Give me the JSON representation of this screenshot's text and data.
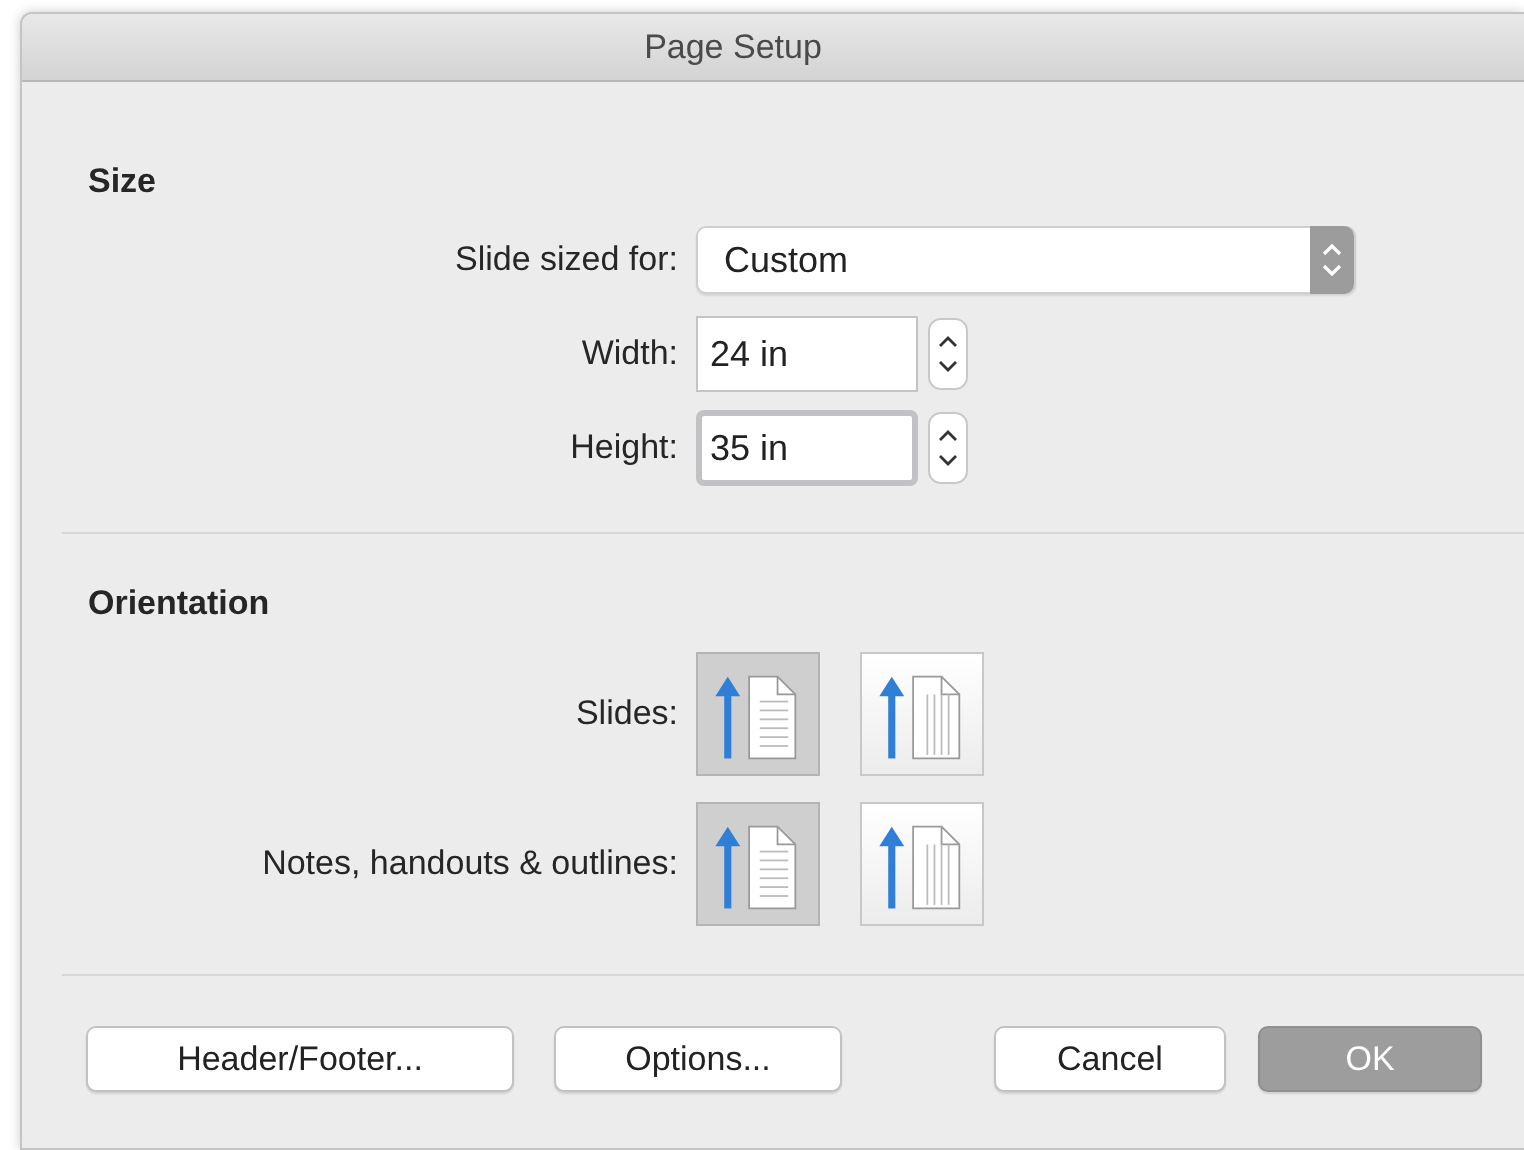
{
  "window": {
    "title": "Page Setup"
  },
  "size": {
    "heading": "Size",
    "slide_sized_for": {
      "label": "Slide sized for:",
      "value": "Custom"
    },
    "fields": [
      {
        "label": "Width:",
        "value": "24 in",
        "focused": false
      },
      {
        "label": "Height:",
        "value": "35 in",
        "focused": true
      }
    ]
  },
  "orientation": {
    "heading": "Orientation",
    "rows": [
      {
        "label": "Slides:",
        "options": [
          {
            "kind": "lines",
            "selected": true
          },
          {
            "kind": "columns",
            "selected": false
          }
        ]
      },
      {
        "label": "Notes, handouts & outlines:",
        "options": [
          {
            "kind": "lines",
            "selected": true
          },
          {
            "kind": "columns",
            "selected": false
          }
        ]
      }
    ]
  },
  "buttons": [
    {
      "label": "Header/Footer...",
      "default": false
    },
    {
      "label": "Options...",
      "default": false
    },
    {
      "label": "Cancel",
      "default": false
    },
    {
      "label": "OK",
      "default": true
    }
  ]
}
